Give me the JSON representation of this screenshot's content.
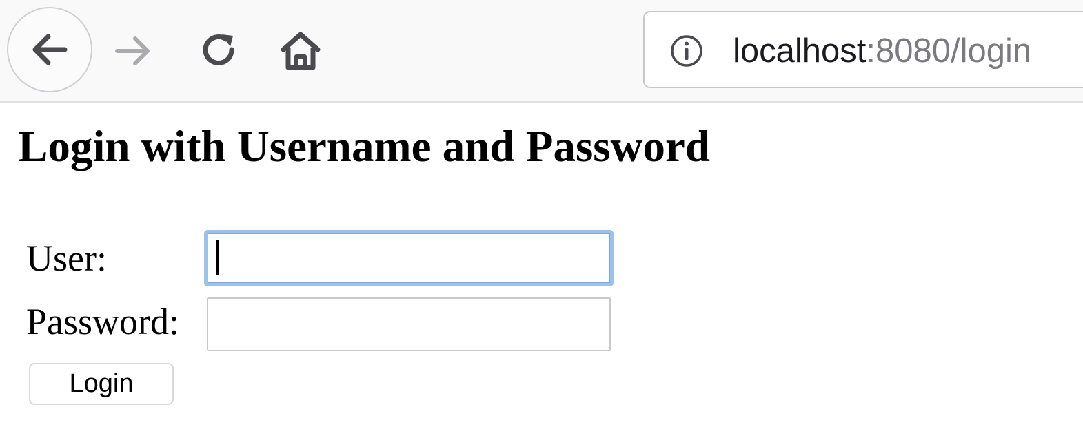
{
  "browser": {
    "url_host": "localhost",
    "url_rest": ":8080/login",
    "icons": {
      "back": "back-arrow-icon",
      "forward": "forward-arrow-icon",
      "reload": "reload-icon",
      "home": "home-icon",
      "info": "info-icon"
    }
  },
  "page": {
    "title": "Login with Username and Password"
  },
  "form": {
    "user_label": "User:",
    "user_value": "",
    "password_label": "Password:",
    "password_value": "",
    "submit_label": "Login"
  },
  "colors": {
    "focus_ring": "#9cc2ec",
    "toolbar_bg": "#f9f9fa",
    "url_muted": "#7a7a80"
  }
}
